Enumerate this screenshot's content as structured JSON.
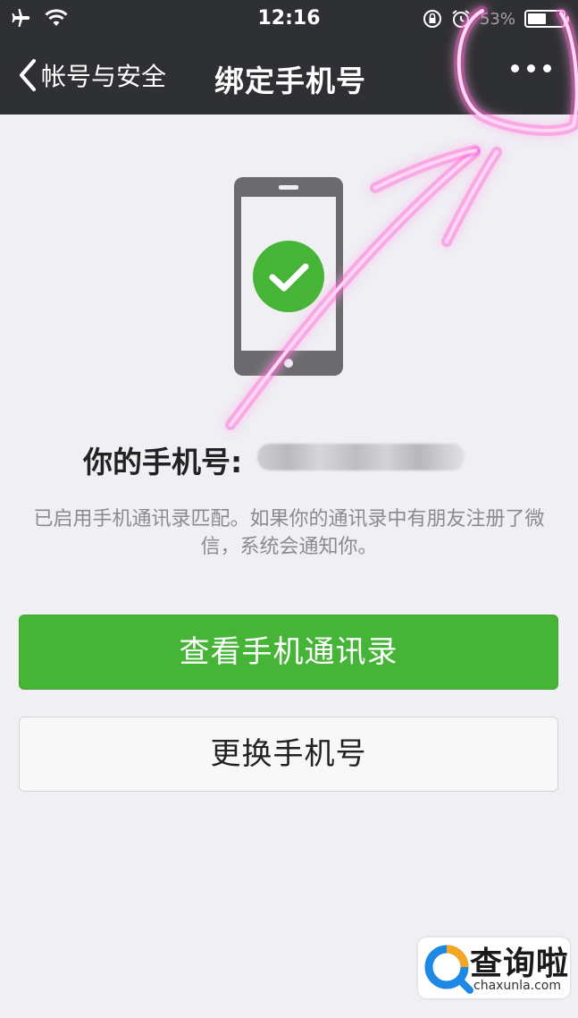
{
  "status_bar": {
    "time": "12:16",
    "battery_text": "53%",
    "battery_level": 0.53
  },
  "nav": {
    "back_label": "帐号与安全",
    "title": "绑定手机号"
  },
  "content": {
    "phone_label": "你的手机号:",
    "description": "已启用手机通讯录匹配。如果你的通讯录中有朋友注册了微信，系统会通知你。",
    "primary_button": "查看手机通讯录",
    "secondary_button": "更换手机号"
  },
  "watermark": {
    "title": "查询啦",
    "url": "chaxunla.com"
  },
  "colors": {
    "nav_bg": "#2f3033",
    "page_bg": "#efeff4",
    "accent_green": "#46b537",
    "annotation_pink": "#ff2ecf"
  }
}
